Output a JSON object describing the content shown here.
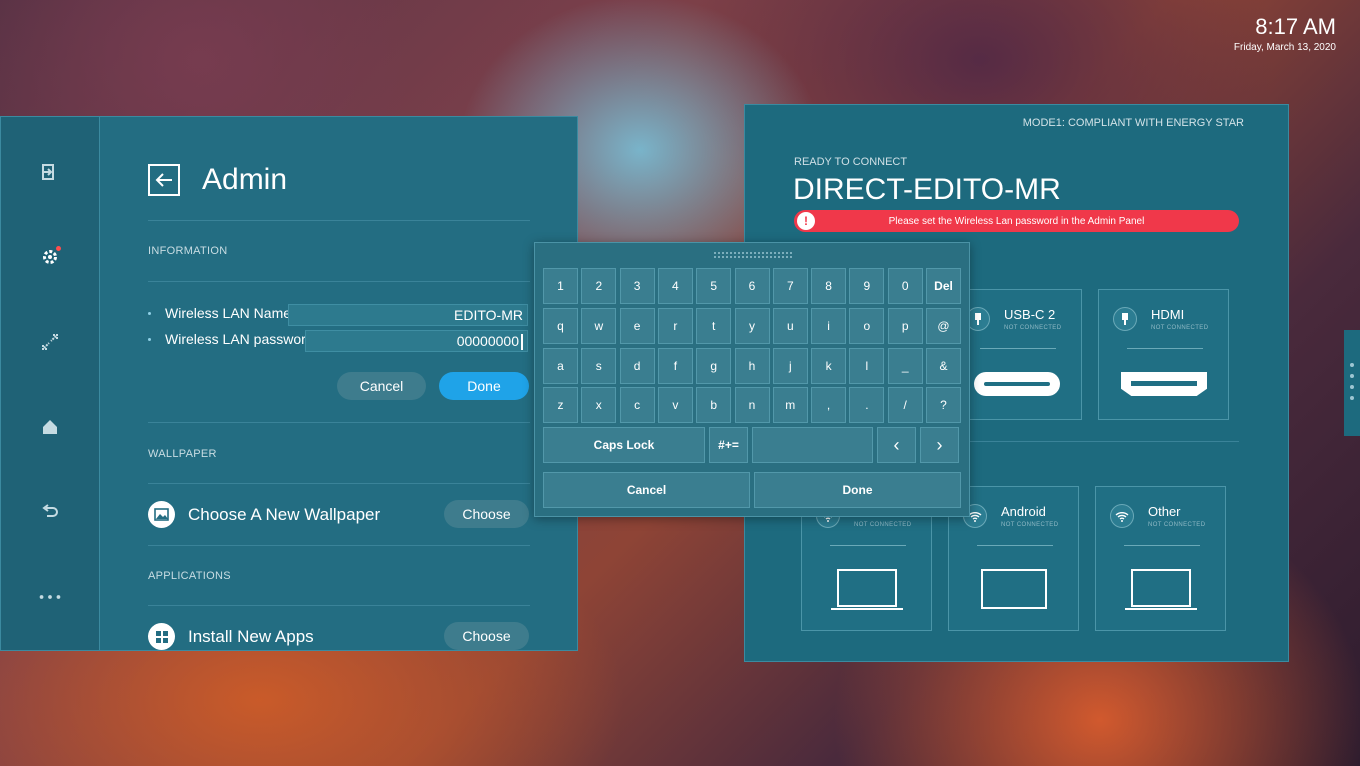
{
  "clock": {
    "time": "8:17 AM",
    "date": "Friday, March 13, 2020"
  },
  "sidebar": {
    "items": [
      {
        "icon": "sign-in-icon"
      },
      {
        "icon": "gear-icon"
      },
      {
        "icon": "screen-share-icon"
      },
      {
        "icon": "home-icon"
      },
      {
        "icon": "undo-icon"
      },
      {
        "icon": "more-icon"
      }
    ]
  },
  "admin": {
    "title": "Admin",
    "info_label": "INFORMATION",
    "wlan_name_label": "Wireless LAN Name:",
    "wlan_name_value": "EDITO-MR",
    "wlan_password_label": "Wireless LAN password:",
    "wlan_password_value": "00000000",
    "cancel_label": "Cancel",
    "done_label": "Done",
    "wallpaper_label": "WALLPAPER",
    "wallpaper_item": "Choose A New Wallpaper",
    "wallpaper_button": "Choose",
    "applications_label": "APPLICATIONS",
    "apps_item": "Install New Apps",
    "apps_button": "Choose"
  },
  "connect": {
    "mode": "MODE1: COMPLIANT WITH ENERGY STAR",
    "ready_label": "READY TO CONNECT",
    "device_name": "DIRECT-EDITO-MR",
    "alert": "Please set the Wireless Lan password in the Admin Panel",
    "alert_icon": "!",
    "sources": [
      {
        "name": "USB-C 2",
        "status": "NOT CONNECTED",
        "icon": "usb-icon"
      },
      {
        "name": "HDMI",
        "status": "NOT CONNECTED",
        "icon": "hdmi-icon"
      },
      {
        "name": "",
        "status": "NOT CONNECTED",
        "icon": "wifi-icon"
      },
      {
        "name": "Android",
        "status": "NOT CONNECTED",
        "icon": "wifi-icon"
      },
      {
        "name": "Other",
        "status": "NOT CONNECTED",
        "icon": "wifi-icon"
      }
    ]
  },
  "keyboard": {
    "row1": [
      "1",
      "2",
      "3",
      "4",
      "5",
      "6",
      "7",
      "8",
      "9",
      "0",
      "Del"
    ],
    "row2": [
      "q",
      "w",
      "e",
      "r",
      "t",
      "y",
      "u",
      "i",
      "o",
      "p",
      "@"
    ],
    "row3": [
      "a",
      "s",
      "d",
      "f",
      "g",
      "h",
      "j",
      "k",
      "l",
      "_",
      "&"
    ],
    "row4": [
      "z",
      "x",
      "c",
      "v",
      "b",
      "n",
      "m",
      ",",
      ".",
      "/",
      "?"
    ],
    "caps_lock": "Caps Lock",
    "symbols": "#+=",
    "space": "",
    "left": "‹",
    "right": "›",
    "cancel": "Cancel",
    "done": "Done"
  },
  "colors": {
    "accent_blue": "#1fa3e8",
    "alert_red": "#f0384a",
    "panel": "#236d82"
  }
}
